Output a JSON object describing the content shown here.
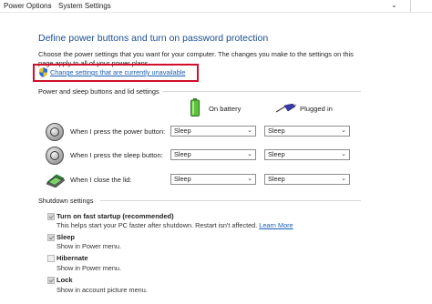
{
  "breadcrumb": {
    "item1": "Power Options",
    "item2": "System Settings"
  },
  "header": {
    "title": "Define power buttons and turn on password protection",
    "description": "Choose the power settings that you want for your computer. The changes you make to the settings on this page apply to all of your power plans.",
    "change_link": "Change settings that are currently unavailable"
  },
  "buttons_section": {
    "label": "Power and sleep buttons and lid settings",
    "col_battery": "On battery",
    "col_plugged": "Plugged in",
    "rows": [
      {
        "label": "When I press the power button:",
        "battery": "Sleep",
        "plugged": "Sleep"
      },
      {
        "label": "When I press the sleep button:",
        "battery": "Sleep",
        "plugged": "Sleep"
      },
      {
        "label": "When I close the lid:",
        "battery": "Sleep",
        "plugged": "Sleep"
      }
    ]
  },
  "shutdown_section": {
    "label": "Shutdown settings",
    "options": [
      {
        "label": "Turn on fast startup (recommended)",
        "desc": "This helps start your PC faster after shutdown. Restart isn't affected.",
        "link": "Learn More",
        "checked": true
      },
      {
        "label": "Sleep",
        "desc": "Show in Power menu.",
        "checked": true
      },
      {
        "label": "Hibernate",
        "desc": "Show in Power menu.",
        "checked": false
      },
      {
        "label": "Lock",
        "desc": "Show in account picture menu.",
        "checked": true
      }
    ]
  },
  "colors": {
    "title": "#1c4e8f",
    "link": "#1a5fb4",
    "highlight_box": "#d0102a"
  }
}
